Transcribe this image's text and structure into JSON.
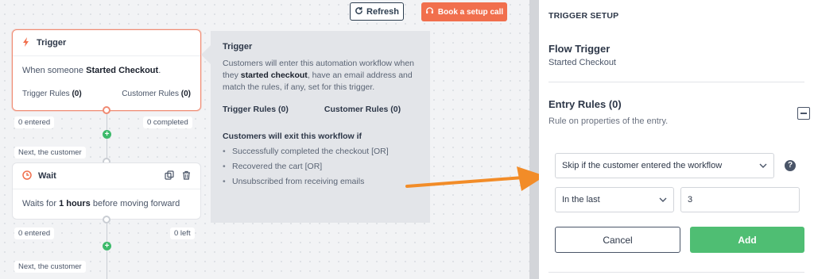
{
  "toolbar": {
    "refresh_label": "Refresh",
    "setup_call_label": "Book a setup call"
  },
  "trigger_node": {
    "title": "Trigger",
    "desc_prefix": "When someone",
    "desc_bold": "Started Checkout",
    "desc_suffix": ".",
    "trigger_rules_label": "Trigger Rules",
    "trigger_rules_count": "(0)",
    "customer_rules_label": "Customer Rules",
    "customer_rules_count": "(0)",
    "entered": "0 entered",
    "completed": "0 completed"
  },
  "next_customer_1": "Next, the customer",
  "wait_node": {
    "title": "Wait",
    "desc_prefix": "Waits for",
    "desc_bold": "1 hours",
    "desc_suffix": "before moving forward",
    "entered": "0 entered",
    "left": "0 left"
  },
  "next_customer_2": "Next, the customer",
  "tooltip": {
    "title": "Trigger",
    "desc_1": "Customers will enter this automation workflow when they",
    "desc_bold": "started checkout",
    "desc_2": ", have an email address and match the rules, if any, set for this trigger.",
    "trigger_rules": "Trigger Rules (0)",
    "customer_rules": "Customer Rules (0)",
    "exit_title": "Customers will exit this workflow if",
    "exit_items": [
      "Successfully completed the checkout [OR]",
      "Recovered the cart [OR]",
      "Unsubscribed from receiving emails"
    ]
  },
  "panel": {
    "title": "TRIGGER SETUP",
    "flow_trigger_label": "Flow Trigger",
    "flow_trigger_value": "Started Checkout",
    "entry_rules_title": "Entry Rules (0)",
    "entry_rules_sub": "Rule on properties of the entry.",
    "skip_select": "Skip if the customer entered the workflow",
    "period_select": "In the last",
    "period_value": "3",
    "cancel_label": "Cancel",
    "add_label": "Add"
  },
  "colors": {
    "accent_orange": "#f16f4d",
    "add_green": "#4fbe73",
    "arrow_orange": "#f28c28"
  }
}
